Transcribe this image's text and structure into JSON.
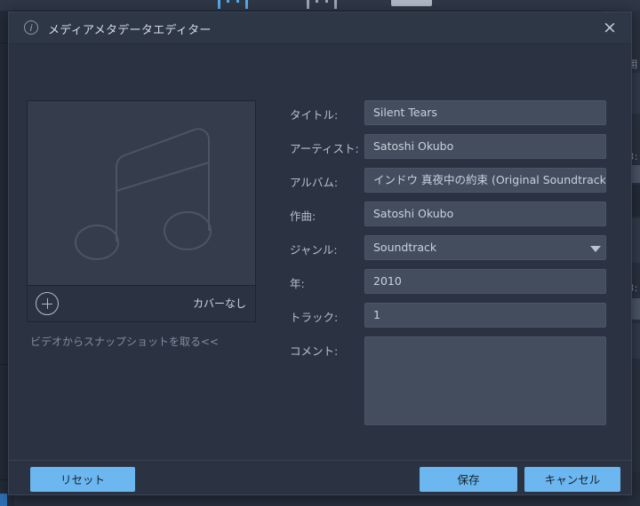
{
  "background": {
    "toolbar_icons": [
      "record-circle-icon",
      "circle-outline-icon",
      "film-strip-icon"
    ],
    "right_panel_text": "用",
    "right_timestamps": [
      "3:",
      "3:"
    ]
  },
  "dialog": {
    "title": "メディアメタデータエディター",
    "info_icon": "info-icon",
    "close_icon": "×"
  },
  "cover": {
    "placeholder_icon": "music-note-icon",
    "add_button_icon": "plus-circle-icon",
    "no_cover_label": "カバーなし",
    "snapshot_link": "ビデオからスナップショットを取る<<"
  },
  "form": {
    "fields": [
      {
        "label": "タイトル:",
        "value": "Silent Tears",
        "type": "text"
      },
      {
        "label": "アーティスト:",
        "value": "Satoshi Okubo",
        "type": "text"
      },
      {
        "label": "アルバム:",
        "value": "インドウ 真夜中の約束 (Original Soundtrack)",
        "type": "text"
      },
      {
        "label": "作曲:",
        "value": "Satoshi Okubo",
        "type": "text"
      },
      {
        "label": "ジャンル:",
        "value": "Soundtrack",
        "type": "select"
      },
      {
        "label": "年:",
        "value": "2010",
        "type": "text"
      },
      {
        "label": "トラック:",
        "value": "1",
        "type": "text"
      },
      {
        "label": "コメント:",
        "value": "",
        "type": "textarea"
      }
    ]
  },
  "footer": {
    "reset_label": "リセット",
    "save_label": "保存",
    "cancel_label": "キャンセル"
  },
  "colors": {
    "dialog_bg": "#2b3342",
    "titlebar_bg": "#2e3746",
    "input_bg": "#434d5e",
    "accent_button": "#6cb7f0",
    "cover_bg": "#353c4b"
  }
}
